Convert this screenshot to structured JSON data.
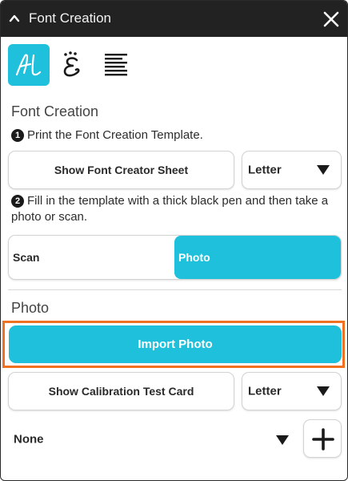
{
  "window": {
    "title": "Font Creation",
    "collapse_icon": "chevron-up-icon",
    "close_icon": "close-icon"
  },
  "mode_icons": [
    {
      "name": "handwriting-mode-icon",
      "active": true
    },
    {
      "name": "glyph-style-mode-icon",
      "active": false
    },
    {
      "name": "text-align-mode-icon",
      "active": false
    }
  ],
  "font_creation": {
    "section_title": "Font Creation",
    "step1_number": "1",
    "step1_text": "Print the Font Creation Template.",
    "show_sheet_label": "Show Font Creator Sheet",
    "paper_size": "Letter",
    "step2_number": "2",
    "step2_text": "Fill in the template with a thick black pen and then take a photo or scan.",
    "source_options": [
      "Scan",
      "Photo"
    ],
    "selected_source": "Photo"
  },
  "photo": {
    "section_title": "Photo",
    "import_label": "Import Photo",
    "calibration_label": "Show Calibration Test Card",
    "calibration_paper_size": "Letter",
    "font_selection": "None",
    "add_icon": "plus-icon"
  },
  "colors": {
    "accent": "#1fc0db",
    "highlight": "#f07121",
    "titlebar": "#222222"
  }
}
